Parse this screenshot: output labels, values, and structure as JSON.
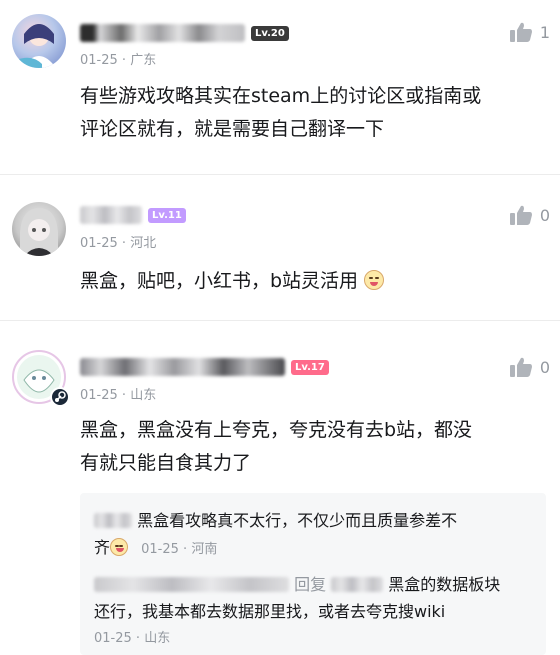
{
  "comments": [
    {
      "level": "Lv.20",
      "level_color": "#3a3a3a",
      "date": "01-25",
      "location": "广东",
      "text_line1": "有些游戏攻略其实在steam上的讨论区或指南或",
      "text_line2": "评论区就有，就是需要自己翻译一下",
      "likes": "1"
    },
    {
      "level": "Lv.11",
      "level_color": "#c29bff",
      "date": "01-25",
      "location": "河北",
      "text": "黑盒，贴吧，小红书，b站灵活用",
      "likes": "0"
    },
    {
      "level": "Lv.17",
      "level_color": "#ff6b8b",
      "date": "01-25",
      "location": "山东",
      "text_line1": "黑盒，黑盒没有上夸克，夸克没有去b站，都没",
      "text_line2": "有就只能自食其力了",
      "likes": "0"
    }
  ],
  "replies": [
    {
      "text_line1": "黑盒看攻略真不太行，不仅少而且质量参差不",
      "text_line2_prefix": "齐",
      "date": "01-25",
      "location": "河南"
    },
    {
      "reply_label": "回复",
      "text_tail": "黑盒的数据板块",
      "text_line2": "还行，我基本都去数据那里找，或者去夸克搜wiki",
      "date": "01-25",
      "location": "山东"
    }
  ],
  "meta_sep": "·",
  "icons": [
    "thumbs-up-icon",
    "emoji-icon",
    "steam-badge-icon"
  ]
}
